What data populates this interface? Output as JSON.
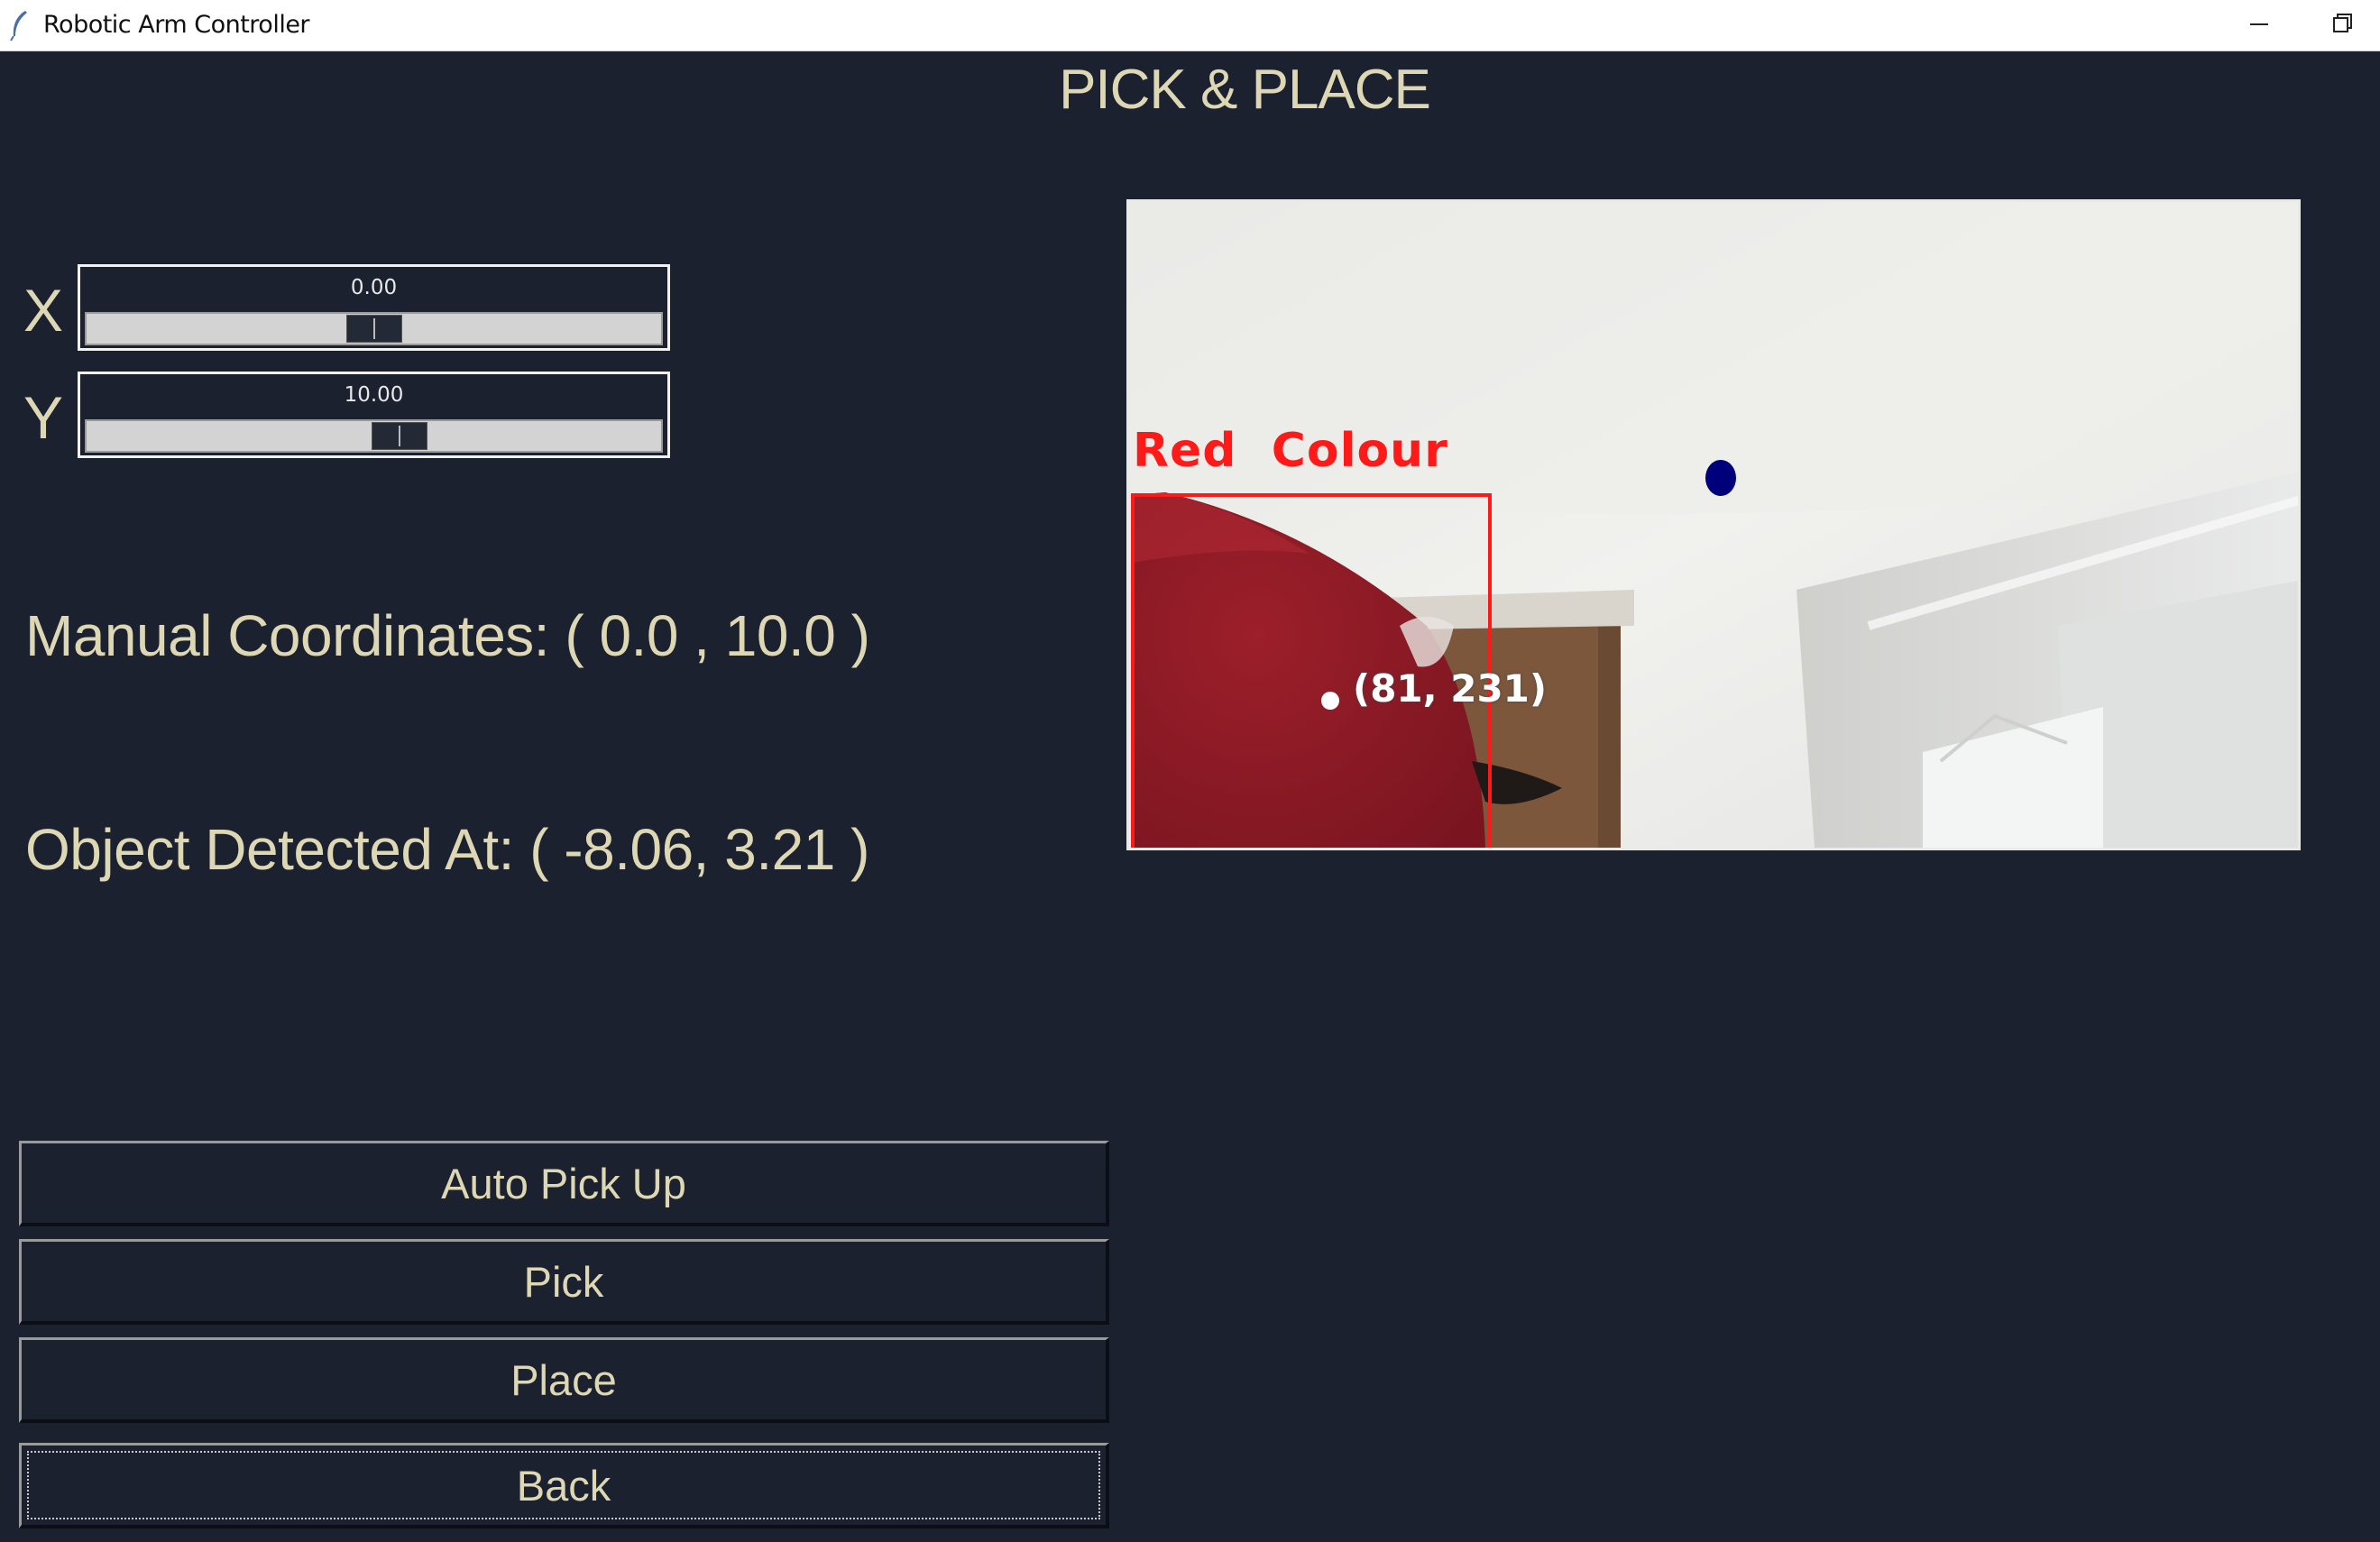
{
  "window": {
    "title": "Robotic Arm Controller"
  },
  "heading": "PICK & PLACE",
  "sliders": [
    {
      "axis_label": "X",
      "value_text": "0.00",
      "level_percent": 50
    },
    {
      "axis_label": "Y",
      "value_text": "10.00",
      "level_percent": 55
    }
  ],
  "manual_coordinates": "Manual Coordinates: ( 0.0 , 10.0 )",
  "object_detected": "Object Detected At: ( -8.06, 3.21 )",
  "buttons": {
    "auto_pick_up": "Auto Pick Up",
    "pick": "Pick",
    "place": "Place",
    "back": "Back"
  },
  "camera": {
    "detection_label": "Red  Colour",
    "centroid_label": "(81, 231)",
    "box_color": "#ff1a1a",
    "marker_color": "#00007a"
  },
  "colors": {
    "background": "#1c2130",
    "text": "#ddd7b4"
  },
  "icons": [
    "feather-icon",
    "minimize-icon",
    "restore-icon"
  ]
}
